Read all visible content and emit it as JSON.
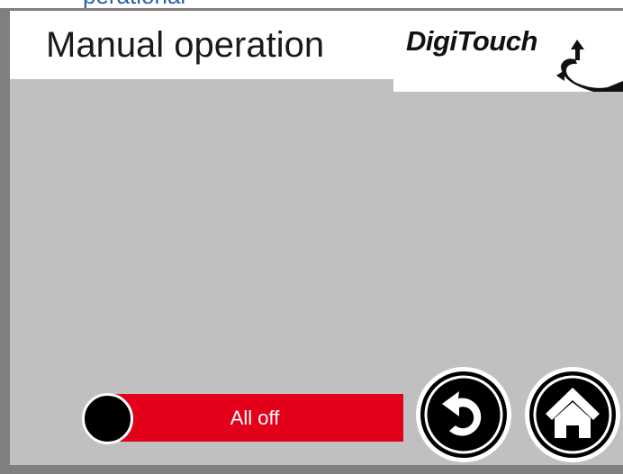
{
  "window": {
    "title_fragment": "perational"
  },
  "header": {
    "title": "Manual operation"
  },
  "logo": {
    "text": "DigiTouch"
  },
  "controls": {
    "toggle": {
      "label": "All off",
      "state": "off",
      "color": "#e2001a"
    },
    "back_button": {
      "icon": "undo-arrow-icon"
    },
    "home_button": {
      "icon": "home-icon"
    }
  },
  "colors": {
    "background": "#c0c0c0",
    "accent": "#e2001a",
    "title_blue": "#2d5fa8"
  }
}
